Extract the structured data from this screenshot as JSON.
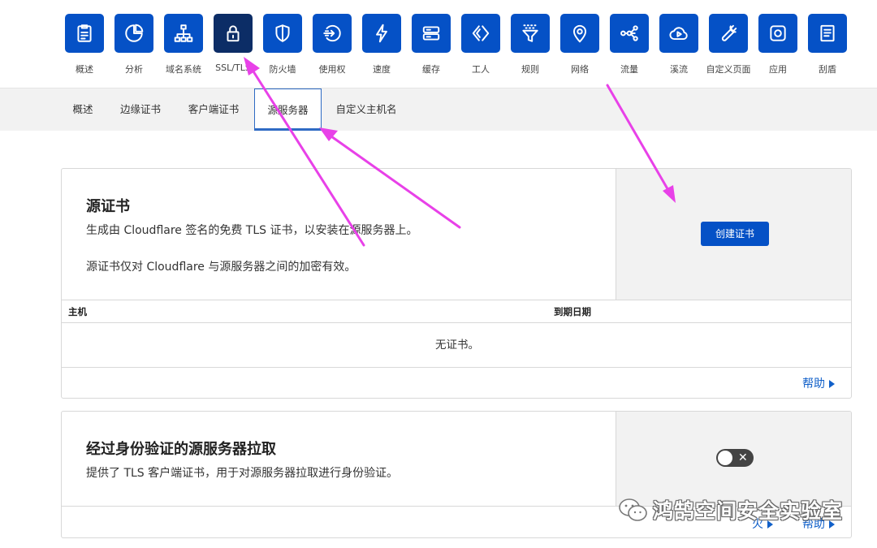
{
  "nav": {
    "items": [
      {
        "label": "概述",
        "icon": "clipboard-icon"
      },
      {
        "label": "分析",
        "icon": "pie-chart-icon"
      },
      {
        "label": "域名系统",
        "icon": "network-icon"
      },
      {
        "label": "SSL/TLS",
        "icon": "lock-icon"
      },
      {
        "label": "防火墙",
        "icon": "shield-icon"
      },
      {
        "label": "使用权",
        "icon": "access-arrow-icon"
      },
      {
        "label": "速度",
        "icon": "lightning-icon"
      },
      {
        "label": "缓存",
        "icon": "server-icon"
      },
      {
        "label": "工人",
        "icon": "code-brackets-icon"
      },
      {
        "label": "规则",
        "icon": "filter-icon"
      },
      {
        "label": "网络",
        "icon": "location-pin-icon"
      },
      {
        "label": "流量",
        "icon": "share-nodes-icon"
      },
      {
        "label": "溪流",
        "icon": "cloud-play-icon"
      },
      {
        "label": "自定义页面",
        "icon": "wrench-icon"
      },
      {
        "label": "应用",
        "icon": "app-square-icon"
      },
      {
        "label": "刮盾",
        "icon": "document-icon"
      }
    ],
    "active_index": 3
  },
  "subnav": {
    "tabs": [
      "概述",
      "边缘证书",
      "客户端证书",
      "源服务器",
      "自定义主机名"
    ],
    "active_index": 3
  },
  "origin_cert": {
    "title": "源证书",
    "description": "生成由 Cloudflare 签名的免费 TLS 证书，以安装在源服务器上。",
    "note": "源证书仅对 Cloudflare 与源服务器之间的加密有效。",
    "create_button": "创建证书",
    "table": {
      "columns": [
        "主机",
        "到期日期"
      ],
      "empty_text": "无证书。"
    },
    "help_label": "帮助"
  },
  "auth_pull": {
    "title": "经过身份验证的源服务器拉取",
    "description": "提供了 TLS 客户端证书，用于对源服务器拉取进行身份验证。",
    "toggle_on": false,
    "footer_extra": "火",
    "help_label": "帮助"
  },
  "watermark": {
    "text": "鸿鹄空间安全实验室",
    "icon": "wechat-icon"
  },
  "colors": {
    "accent": "#0551c6",
    "active_tile": "#0c2d66",
    "annotation_arrow": "#e841e8",
    "link": "#1160c9"
  }
}
